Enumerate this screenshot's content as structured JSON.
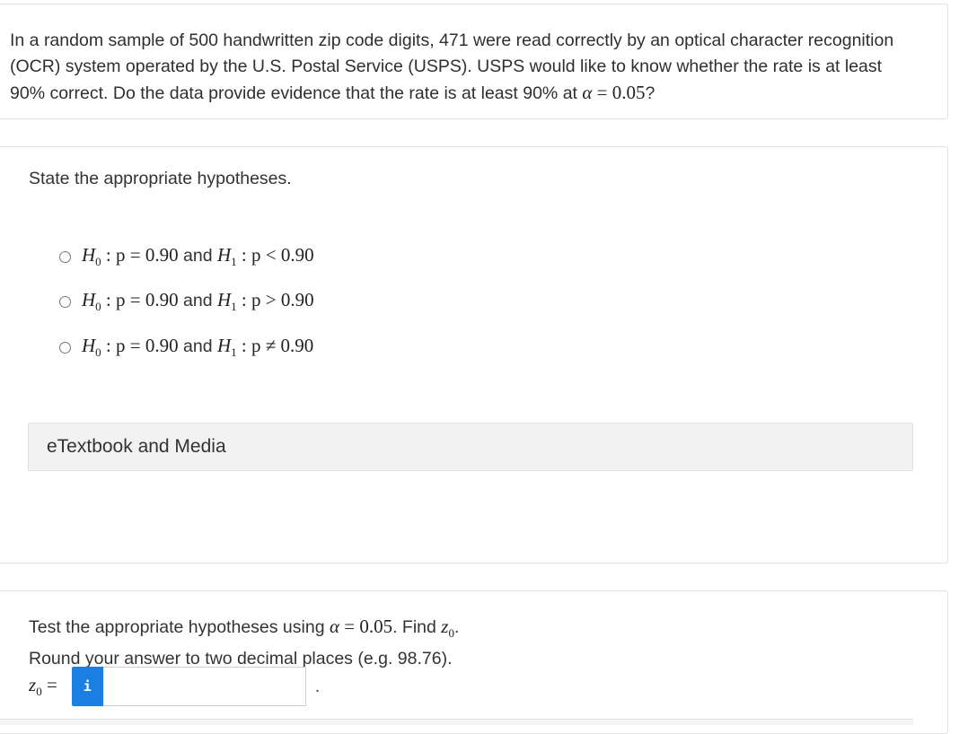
{
  "question": {
    "part1": "In a random sample of 500 handwritten zip code digits, 471 were read correctly by an optical character recognition (OCR) system operated by the U.S. Postal Service (USPS). USPS would like to know whether the rate is at least 90% correct. Do the data provide evidence that the rate is at least 90% at ",
    "alpha_symbol": "α",
    "equals": " = ",
    "alpha_value": "0.05",
    "end": "?"
  },
  "hypotheses": {
    "prompt": "State the appropriate hypotheses.",
    "options": [
      {
        "h0": "H",
        "h0_sub": "0",
        "h0_rest": " : p = 0.90",
        "and": " and ",
        "h1": "H",
        "h1_sub": "1",
        "h1_rest": " : p < 0.90",
        "selected": false
      },
      {
        "h0": "H",
        "h0_sub": "0",
        "h0_rest": " : p = 0.90",
        "and": " and ",
        "h1": "H",
        "h1_sub": "1",
        "h1_rest": " : p > 0.90",
        "selected": false
      },
      {
        "h0": "H",
        "h0_sub": "0",
        "h0_rest": " : p = 0.90",
        "and": " and ",
        "h1": "H",
        "h1_sub": "1",
        "h1_rest": " : p ≠ 0.90",
        "selected": false
      }
    ],
    "etextbook_label": "eTextbook and Media"
  },
  "test": {
    "line1_a": "Test the appropriate hypotheses using ",
    "alpha_symbol": "α",
    "equals": " = ",
    "alpha_value": "0.05",
    "line1_b": ". Find ",
    "z": "z",
    "z_sub": "0",
    "line1_c": ".",
    "line2": "Round your answer to two decimal places (e.g. 98.76).",
    "answer_label_z": "z",
    "answer_label_sub": "0",
    "answer_label_eq": " =",
    "info_icon": "i",
    "answer_value": "",
    "answer_suffix": "."
  },
  "colors": {
    "info_button": "#1a7fe0",
    "card_border": "#e2e2e2",
    "etext_bg": "#f2f2f2"
  }
}
